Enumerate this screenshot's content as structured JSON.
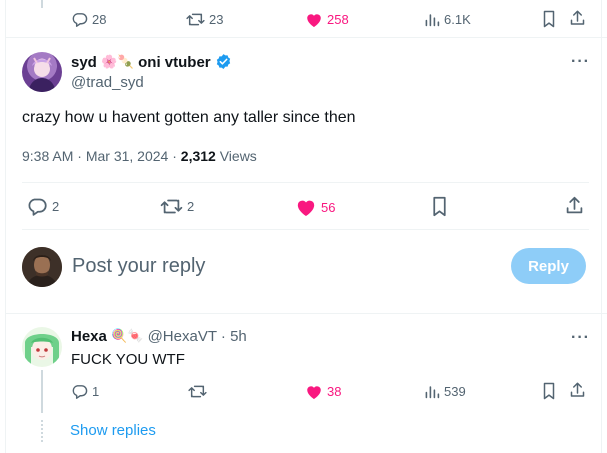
{
  "top_actions": {
    "replies": "28",
    "reposts": "23",
    "likes": "258",
    "views": "6.1K"
  },
  "main_tweet": {
    "name": "syd",
    "name_emojis": "🌸🍡",
    "name_suffix": "oni vtuber",
    "handle": "@trad_syd",
    "text": "crazy how u havent gotten any taller since then",
    "time": "9:38 AM",
    "date": "Mar 31, 2024",
    "separator": "·",
    "views_count": "2,312",
    "views_label": "Views",
    "actions": {
      "replies": "2",
      "reposts": "2",
      "likes": "56"
    }
  },
  "composer": {
    "placeholder": "Post your reply",
    "button_label": "Reply"
  },
  "reply": {
    "name": "Hexa",
    "name_emojis": "🍭🍬",
    "handle": "@HexaVT",
    "separator": "·",
    "time_ago": "5h",
    "text": "FUCK YOU WTF",
    "actions": {
      "replies": "1",
      "reposts": "",
      "likes": "38",
      "views": "539"
    },
    "show_replies": "Show replies"
  },
  "colors": {
    "accent": "#1d9bf0",
    "like": "#f91880",
    "muted": "#536471",
    "reply_button": "#8ecdf8"
  }
}
